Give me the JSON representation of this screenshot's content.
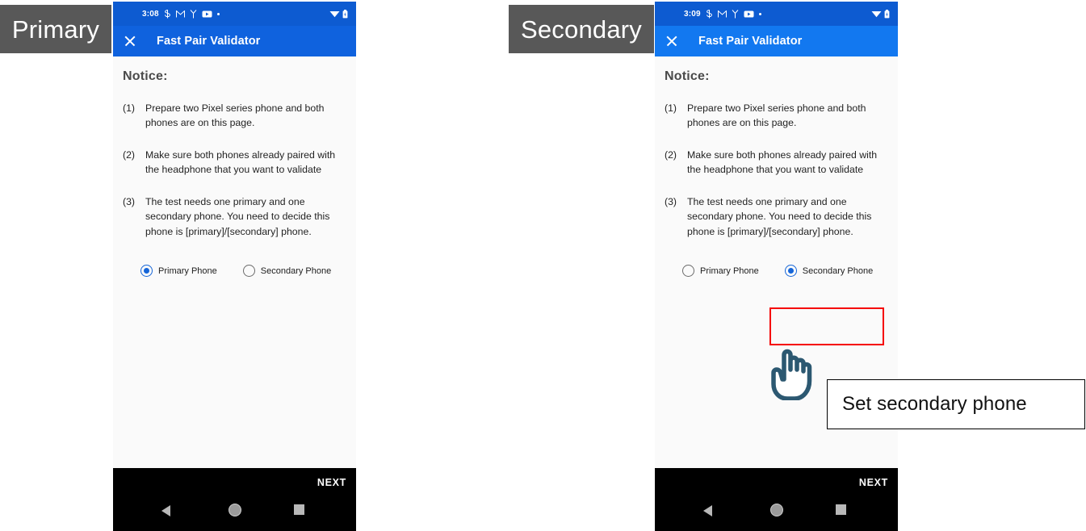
{
  "annotations": {
    "primary_label": "Primary",
    "secondary_label": "Secondary",
    "callout_text": "Set secondary phone",
    "highlight_color": "#f50000",
    "callout_border_color": "#000000",
    "cursor_icon": "pointing-hand-cursor"
  },
  "theme": {
    "statusbar_bg": "#0d5bd1",
    "appbar_primary_bg": "#0f62de",
    "appbar_secondary_bg": "#1278f0",
    "accent": "#1565d8",
    "content_bg": "#fafafa",
    "navbar_bg": "#000000"
  },
  "phones": [
    {
      "id": "primary",
      "statusbar": {
        "time": "3:08",
        "icons": [
          "link-icon",
          "gmail-icon",
          "merge-icon",
          "youtube-icon",
          "more-dot-icon"
        ],
        "right_icons": [
          "wifi-icon",
          "battery-icon"
        ]
      },
      "appbar": {
        "close_icon": "close-icon",
        "title": "Fast Pair Validator"
      },
      "content": {
        "notice_heading": "Notice:",
        "steps": [
          {
            "num": "(1)",
            "text": "Prepare two Pixel series phone and both phones are on this page."
          },
          {
            "num": "(2)",
            "text": "Make sure both phones already paired with the headphone that you want to validate"
          },
          {
            "num": "(3)",
            "text": "The test needs one primary and one secondary phone. You need to decide this phone is [primary]/[secondary] phone."
          }
        ],
        "radio_options": [
          {
            "label": "Primary Phone",
            "checked": true
          },
          {
            "label": "Secondary Phone",
            "checked": false
          }
        ]
      },
      "bottom": {
        "next_label": "NEXT",
        "nav_icons": [
          "back-triangle-icon",
          "home-circle-icon",
          "recents-square-icon"
        ]
      }
    },
    {
      "id": "secondary",
      "statusbar": {
        "time": "3:09",
        "icons": [
          "link-icon",
          "gmail-icon",
          "merge-icon",
          "youtube-icon",
          "more-dot-icon"
        ],
        "right_icons": [
          "wifi-icon",
          "battery-icon"
        ]
      },
      "appbar": {
        "close_icon": "close-icon",
        "title": "Fast Pair Validator"
      },
      "content": {
        "notice_heading": "Notice:",
        "steps": [
          {
            "num": "(1)",
            "text": "Prepare two Pixel series phone and both phones are on this page."
          },
          {
            "num": "(2)",
            "text": "Make sure both phones already paired with the headphone that you want to validate"
          },
          {
            "num": "(3)",
            "text": "The test needs one primary and one secondary phone. You need to decide this phone is [primary]/[secondary] phone."
          }
        ],
        "radio_options": [
          {
            "label": "Primary Phone",
            "checked": false
          },
          {
            "label": "Secondary Phone",
            "checked": true
          }
        ]
      },
      "bottom": {
        "next_label": "NEXT",
        "nav_icons": [
          "back-triangle-icon",
          "home-circle-icon",
          "recents-square-icon"
        ]
      }
    }
  ]
}
